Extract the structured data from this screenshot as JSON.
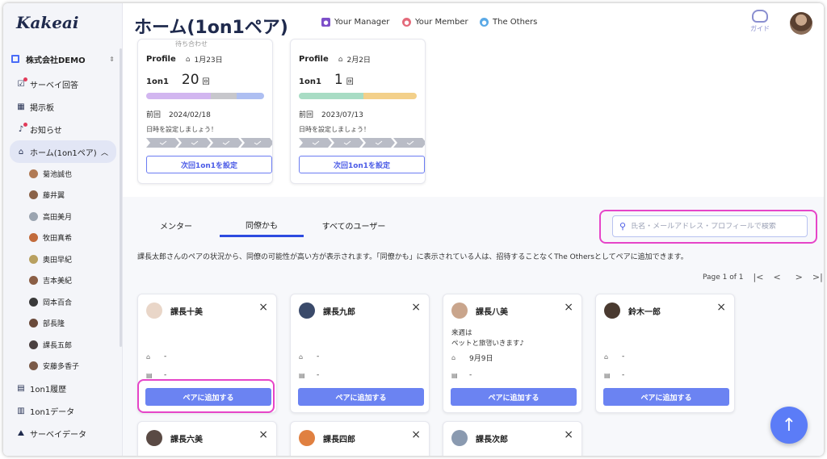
{
  "app": {
    "logo": "Kakeai",
    "page_title": "ホーム(1on1ペア)"
  },
  "header": {
    "legend": [
      {
        "label": "Your Manager",
        "color": "#7d4fc9",
        "icon": "person-icon"
      },
      {
        "label": "Your Member",
        "color": "#e46a7a",
        "icon": "person-icon"
      },
      {
        "label": "The Others",
        "color": "#5aa9e6",
        "icon": "person-icon"
      }
    ],
    "guide_label": "ガイド"
  },
  "sidebar": {
    "company": "株式会社DEMO",
    "items": [
      {
        "label": "サーベイ回答",
        "icon": "survey-icon",
        "badge": true
      },
      {
        "label": "掲示板",
        "icon": "board-icon",
        "badge": false
      },
      {
        "label": "お知らせ",
        "icon": "bell-icon",
        "badge": true
      },
      {
        "label": "ホーム(1on1ペア)",
        "icon": "home-icon",
        "badge": false,
        "active": true
      }
    ],
    "sub_items": [
      {
        "label": "菊池誠也",
        "color": "#b07a55"
      },
      {
        "label": "藤井翼",
        "color": "#8a6248"
      },
      {
        "label": "高田美月",
        "color": "#9aa4b0"
      },
      {
        "label": "牧田真希",
        "color": "#c26b3c"
      },
      {
        "label": "奥田早紀",
        "color": "#b8a060"
      },
      {
        "label": "吉本美紀",
        "color": "#8a5e45"
      },
      {
        "label": "岡本百合",
        "color": "#3a3a3a"
      },
      {
        "label": "部長隆",
        "color": "#6a4a3a"
      },
      {
        "label": "課長五郎",
        "color": "#4a4040"
      },
      {
        "label": "安藤多香子",
        "color": "#7a5a48"
      }
    ],
    "bottom_items": [
      {
        "label": "1on1履歴",
        "icon": "history-icon"
      },
      {
        "label": "1on1データ",
        "icon": "chart-icon"
      },
      {
        "label": "サーベイデータ",
        "icon": "survey-data-icon"
      }
    ]
  },
  "pair_cards": [
    {
      "cut_text": "待ち合わせ",
      "profile_label": "Profile",
      "birthday": "1月23日",
      "count_label": "1on1",
      "count": "20",
      "count_unit": "回",
      "bar": [
        {
          "share": 0.55,
          "color": "#d2b6f0"
        },
        {
          "share": 0.22,
          "color": "#c7c7cc"
        },
        {
          "share": 0.23,
          "color": "#aebff2"
        }
      ],
      "last_label": "前回",
      "last_date": "2024/02/18",
      "hint": "日時を設定しましょう！",
      "button": "次回1on1を設定"
    },
    {
      "cut_text": "",
      "profile_label": "Profile",
      "birthday": "2月2日",
      "count_label": "1on1",
      "count": "1",
      "count_unit": "回",
      "bar": [
        {
          "share": 0.55,
          "color": "#a8dcc4"
        },
        {
          "share": 0.45,
          "color": "#f3d08a"
        }
      ],
      "last_label": "前回",
      "last_date": "2023/07/13",
      "hint": "日時を設定しましょう！",
      "button": "次回1on1を設定"
    }
  ],
  "tabs": [
    {
      "label": "メンター",
      "active": false
    },
    {
      "label": "同僚かも",
      "active": true
    },
    {
      "label": "すべてのユーザー",
      "active": false
    }
  ],
  "search": {
    "placeholder": "氏名・メールアドレス・プロフィールで検索"
  },
  "description": "課長太郎さんのペアの状況から、同僚の可能性が高い方が表示されます。「同僚かも」に表示されている人は、招待することなくThe Othersとしてペアに追加できます。",
  "pager": {
    "label": "Page 1 of 1",
    "first": "|<",
    "prev": "<",
    "next": ">",
    "last": ">|"
  },
  "user_cards": [
    {
      "name": "課長十美",
      "note": "",
      "birthday": "-",
      "other": "-",
      "button": "ペアに追加する",
      "avatar": "#e9d6c8"
    },
    {
      "name": "課長九郎",
      "note": "",
      "birthday": "-",
      "other": "-",
      "button": "ペアに追加する",
      "avatar": "#3a4a6a"
    },
    {
      "name": "課長八美",
      "note": "来週は\nペットと旅행いきます♪",
      "birthday": "9月9日",
      "other": "-",
      "button": "ペアに追加する",
      "avatar": "#c9a58c"
    },
    {
      "name": "鈴木一郎",
      "note": "",
      "birthday": "-",
      "other": "-",
      "button": "ペアに追加する",
      "avatar": "#4a3a30"
    },
    {
      "name": "課長六美",
      "avatar": "#5a4a44"
    },
    {
      "name": "課長四郎",
      "avatar": "#e08040"
    },
    {
      "name": "課長次郎",
      "avatar": "#8a9ab0"
    }
  ],
  "fab": {
    "icon": "arrow-up-icon",
    "glyph": "↑"
  },
  "icons": {
    "close": "×",
    "cake": "⌂",
    "caret_up": "︿",
    "updown": "⇕",
    "search": "⚲"
  }
}
